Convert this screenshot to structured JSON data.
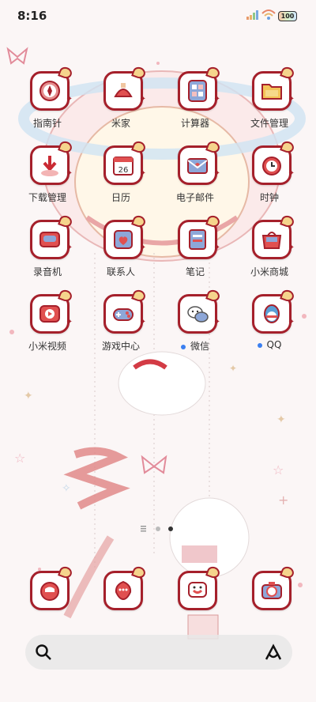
{
  "status": {
    "time": "8:16",
    "battery": "100"
  },
  "apps": [
    {
      "label": "指南针",
      "icon": "compass-icon"
    },
    {
      "label": "米家",
      "icon": "mijia-icon"
    },
    {
      "label": "计算器",
      "icon": "calculator-icon"
    },
    {
      "label": "文件管理",
      "icon": "folder-icon"
    },
    {
      "label": "下载管理",
      "icon": "download-icon"
    },
    {
      "label": "日历",
      "icon": "calendar-icon",
      "date": "26"
    },
    {
      "label": "电子邮件",
      "icon": "mail-icon"
    },
    {
      "label": "时钟",
      "icon": "clock-icon"
    },
    {
      "label": "录音机",
      "icon": "recorder-icon"
    },
    {
      "label": "联系人",
      "icon": "contacts-icon"
    },
    {
      "label": "笔记",
      "icon": "notes-icon"
    },
    {
      "label": "小米商城",
      "icon": "store-icon"
    },
    {
      "label": "小米视频",
      "icon": "video-icon"
    },
    {
      "label": "游戏中心",
      "icon": "gamepad-icon"
    },
    {
      "label": "微信",
      "icon": "wechat-icon"
    },
    {
      "label": "QQ",
      "icon": "qq-icon"
    }
  ],
  "dock": [
    {
      "icon": "phone-icon"
    },
    {
      "icon": "messages-icon"
    },
    {
      "icon": "browser-icon"
    },
    {
      "icon": "camera-icon"
    }
  ],
  "colors": {
    "accent": "#a5202b",
    "wallpaper": "#fbf6f6",
    "notify": "#3b7ff0"
  }
}
